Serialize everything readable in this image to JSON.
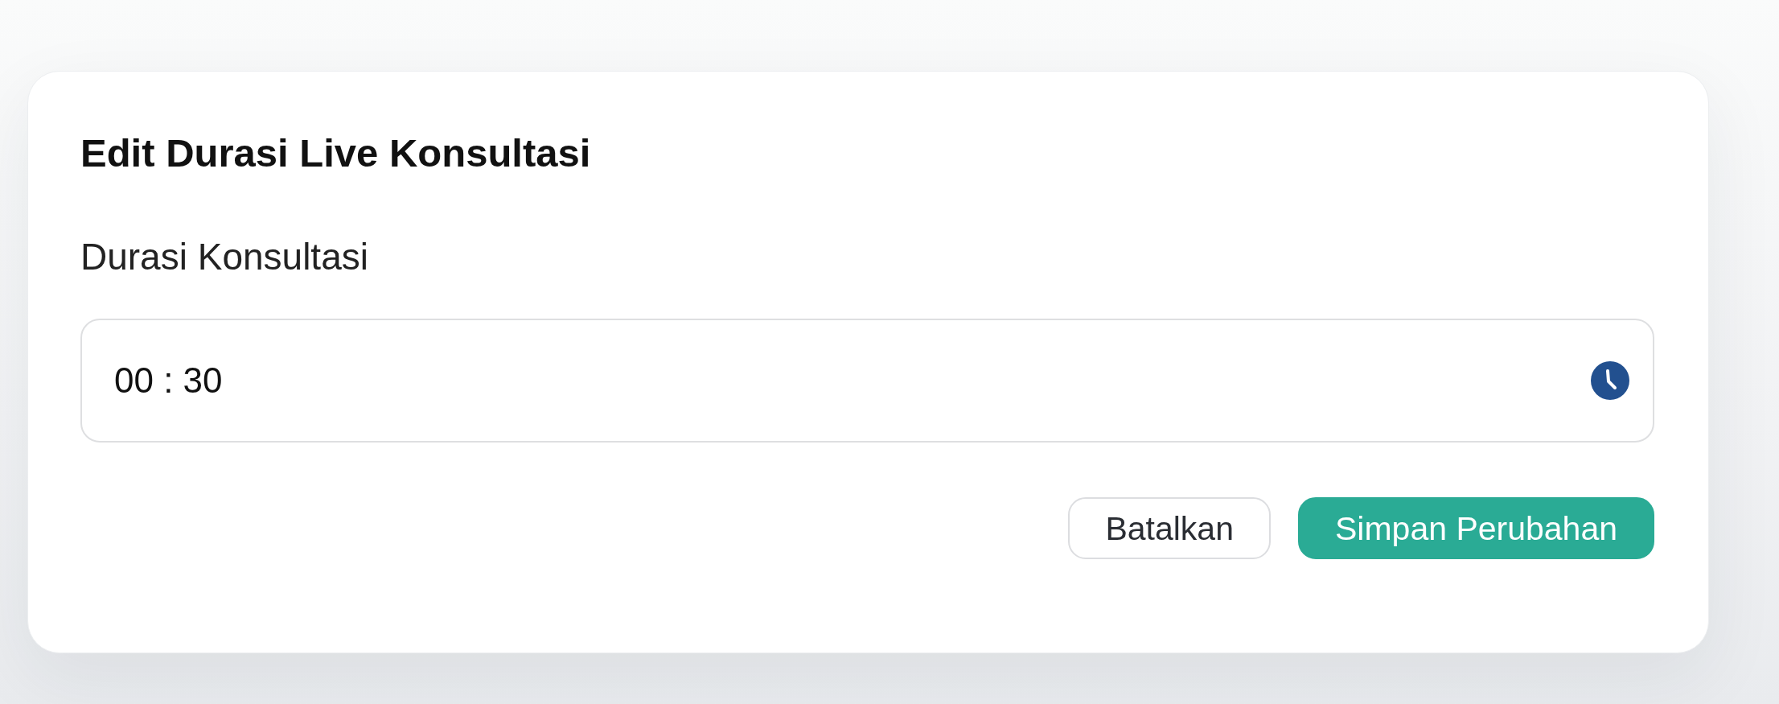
{
  "dialog": {
    "title": "Edit Durasi Live Konsultasi",
    "field": {
      "label": "Durasi Konsultasi",
      "value": "00 : 30"
    },
    "buttons": [
      {
        "label": "Batalkan",
        "kind": "secondary"
      },
      {
        "label": "Simpan Perubahan",
        "kind": "primary"
      }
    ]
  }
}
